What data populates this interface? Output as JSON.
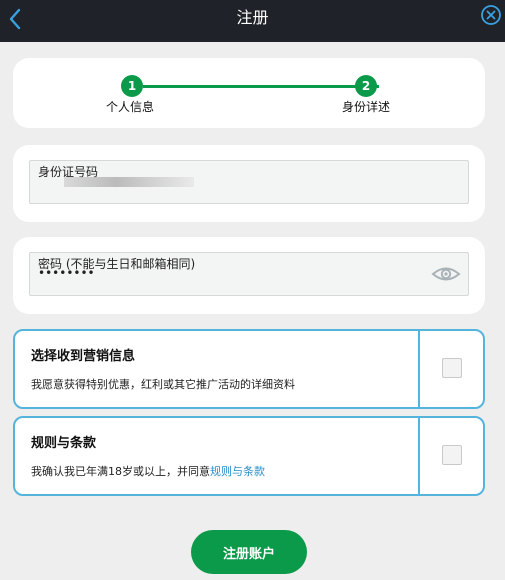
{
  "header": {
    "title": "注册"
  },
  "stepper": {
    "steps": [
      {
        "number": "1",
        "label": "个人信息"
      },
      {
        "number": "2",
        "label": "身份详述"
      }
    ]
  },
  "id_field": {
    "label": "身份证号码",
    "value": ""
  },
  "password_field": {
    "label": "密码 (不能与生日和邮箱相同)",
    "value": "••••••••"
  },
  "marketing": {
    "title": "选择收到营销信息",
    "description": "我愿意获得特别优惠，红利或其它推广活动的详细资料"
  },
  "terms": {
    "title": "规则与条款",
    "description_prefix": "我确认我已年满18岁或以上，并同意",
    "link_text": "规则与条款"
  },
  "submit": {
    "label": "注册账户"
  },
  "colors": {
    "accent_green": "#0a9a4a",
    "option_border_blue": "#55b4dc",
    "header_dark": "#1f2329",
    "link_blue": "#2a8fc9"
  },
  "icons": {
    "back": "chevron-left-icon",
    "close": "close-circle-icon",
    "password_toggle": "eye-icon"
  }
}
